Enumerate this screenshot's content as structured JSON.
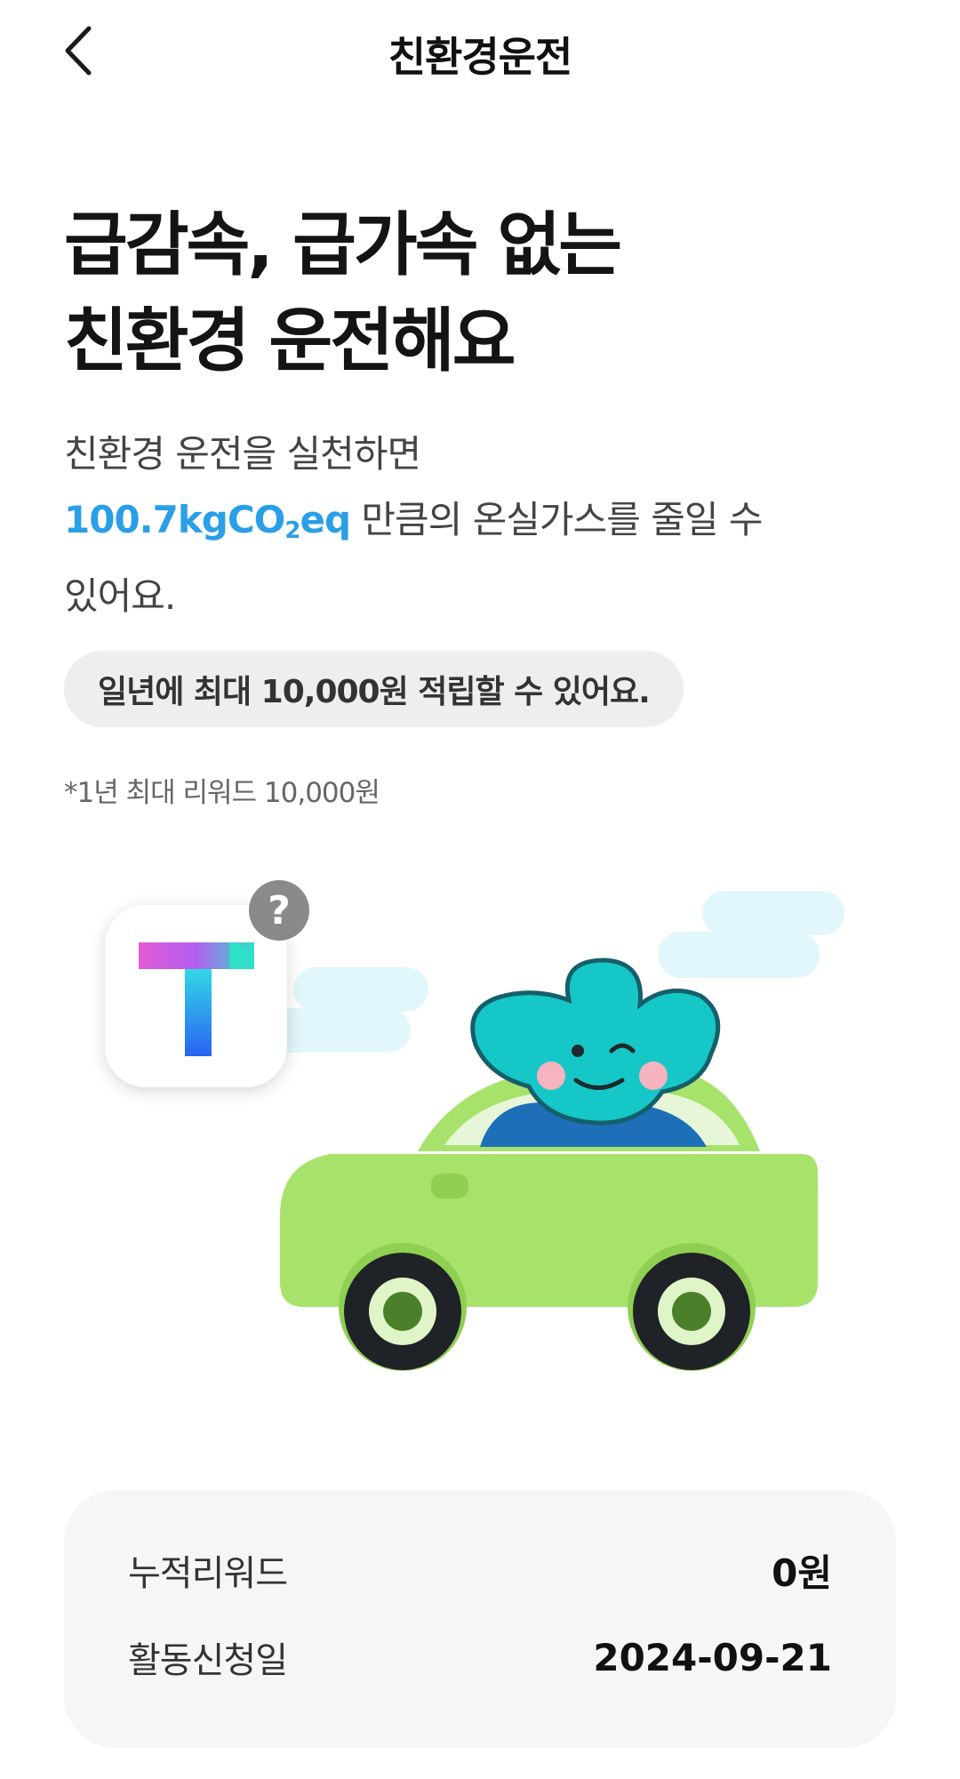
{
  "header": {
    "title": "친환경운전",
    "back_icon": "chevron-left-icon"
  },
  "hero": {
    "headline_line1": "급감속, 급가속 없는",
    "headline_line2": "친환경 운전해요",
    "desc_line1": "친환경 운전을 실천하면",
    "highlight_main": "100.7kgCO",
    "highlight_sub": "2",
    "highlight_end": "eq",
    "desc_line2_rest": " 만큼의 온실가스를 줄일 수",
    "desc_line3": "있어요.",
    "highlight_color": "#2a9fe8"
  },
  "reward_pill": "일년에 최대 10,000원 적립할 수 있어요.",
  "reward_note": "*1년 최대 리워드 10,000원",
  "illustration": {
    "app_icon": "t-app-icon",
    "help_badge": "?",
    "character": "eco-mascot-in-car"
  },
  "summary": {
    "rows": [
      {
        "label": "누적리워드",
        "value": "0원"
      },
      {
        "label": "활동신청일",
        "value": "2024-09-21"
      }
    ]
  },
  "colors": {
    "accent": "#2a9fe8",
    "car_body": "#a7e26a",
    "mascot": "#16c7c7",
    "cloud": "#e2f7fb"
  }
}
